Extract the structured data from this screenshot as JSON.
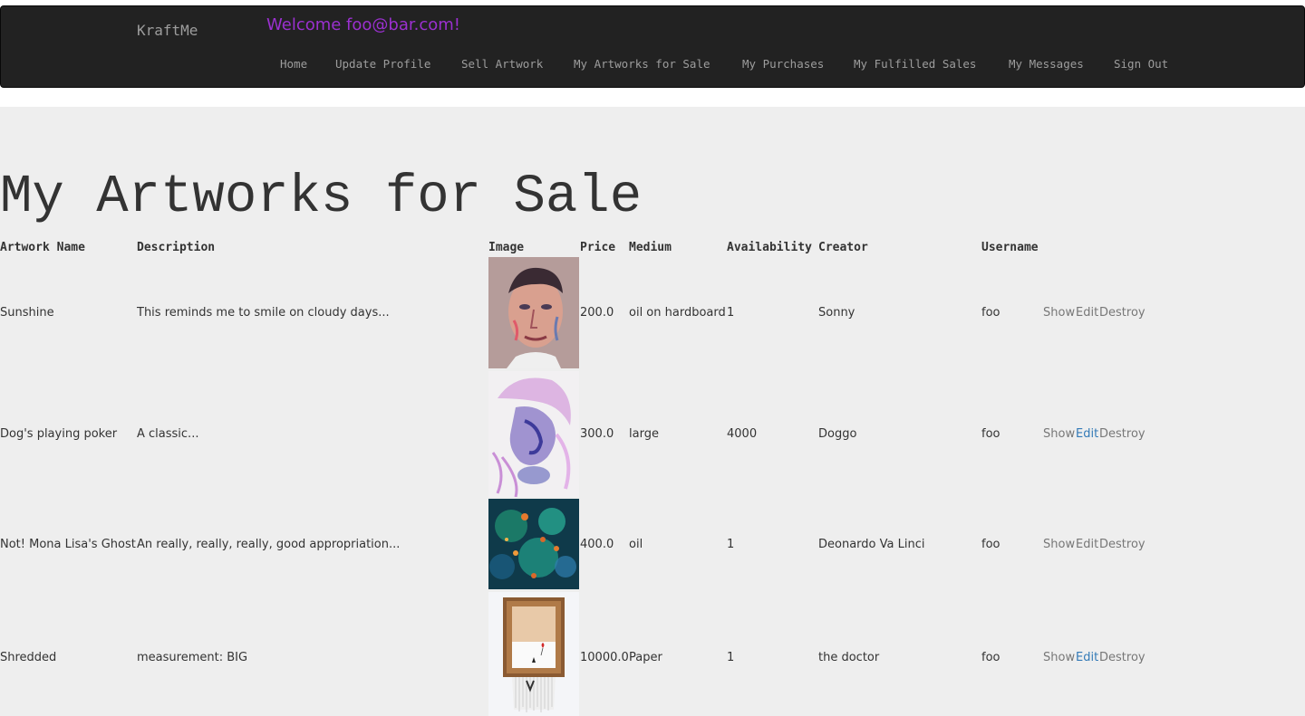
{
  "navbar": {
    "brand": "KraftMe",
    "welcome": "Welcome foo@bar.com!",
    "links": [
      "Home",
      "Update Profile",
      "Sell Artwork",
      "My Artworks for Sale",
      "My Purchases",
      "My Fulfilled Sales",
      "My Messages",
      "Sign Out"
    ]
  },
  "page": {
    "title": "My Artworks for Sale"
  },
  "table": {
    "headers": [
      "Artwork Name",
      "Description",
      "Image",
      "Price",
      "Medium",
      "Availability",
      "Creator",
      "Username"
    ],
    "actions": [
      "Show",
      "Edit",
      "Destroy"
    ],
    "rows": [
      {
        "name": "Sunshine",
        "description": "This reminds me to smile on cloudy days...",
        "price": "200.0",
        "medium": "oil on hardboard",
        "availability": "1",
        "creator": "Sonny",
        "username": "foo",
        "image": "portrait-painting"
      },
      {
        "name": "Dog's playing poker",
        "description": "A classic...",
        "price": "300.0",
        "medium": "large",
        "availability": "4000",
        "creator": "Doggo",
        "username": "foo",
        "image": "watercolor-face"
      },
      {
        "name": "Not! Mona Lisa's Ghost",
        "description": "An really, really, really, good appropriation...",
        "price": "400.0",
        "medium": "oil",
        "availability": "1",
        "creator": "Deonardo Va Linci",
        "username": "foo",
        "image": "koi-pond-painting"
      },
      {
        "name": "Shredded",
        "description": "measurement: BIG",
        "price": "10000.0",
        "medium": "Paper",
        "availability": "1",
        "creator": "the doctor",
        "username": "foo",
        "image": "shredded-framed-artwork"
      }
    ]
  },
  "colors": {
    "navbar_bg": "#222222",
    "nav_text": "#9d9d9d",
    "welcome": "#9b30d0",
    "link_active": "#337ab7",
    "page_bg": "#eeeeee"
  }
}
